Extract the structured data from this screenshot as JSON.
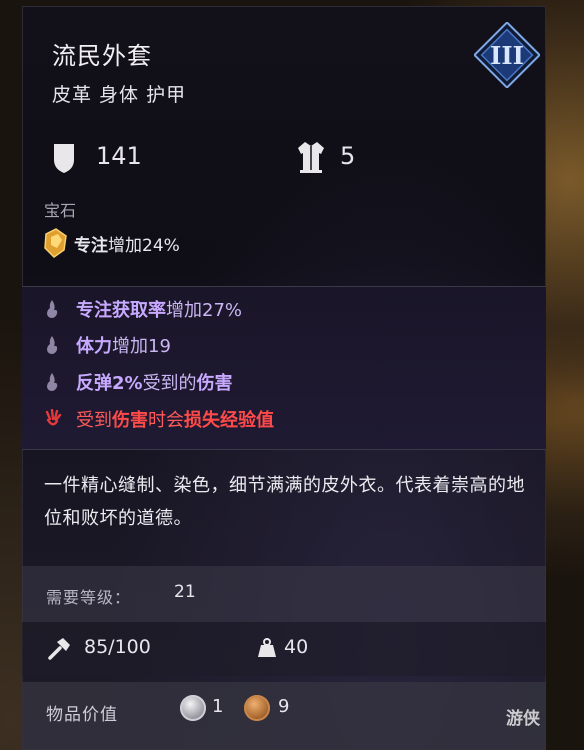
{
  "item": {
    "name": "流民外套",
    "type_line": "皮革 身体 护甲",
    "tier": "III",
    "armor": "141",
    "weight_class": "5"
  },
  "gem": {
    "label": "宝石",
    "stat_name": "专注",
    "stat_text": "增加24%"
  },
  "perks": [
    {
      "icon": "purple-flame-icon",
      "bold": "专注获取率",
      "text": "增加27%"
    },
    {
      "icon": "purple-flame-icon",
      "bold": "体力",
      "text": "增加19"
    },
    {
      "icon": "purple-flame-icon",
      "bold": "反弹2%",
      "text": "受到的",
      "bold2": "伤害"
    },
    {
      "icon": "red-claw-icon",
      "text_a": "受到",
      "bold_a": "伤害",
      "text_b": "时会",
      "bold_b": "损失经验值"
    }
  ],
  "description": "一件精心缝制、染色，细节满满的皮外衣。代表着崇高的地位和败坏的道德。",
  "requirement": {
    "label": "需要等级：",
    "value": "21"
  },
  "utility": {
    "durability": "85/100",
    "weight": "40"
  },
  "value": {
    "label": "物品价值",
    "silver": "1",
    "copper": "9"
  },
  "watermark": "游侠"
}
